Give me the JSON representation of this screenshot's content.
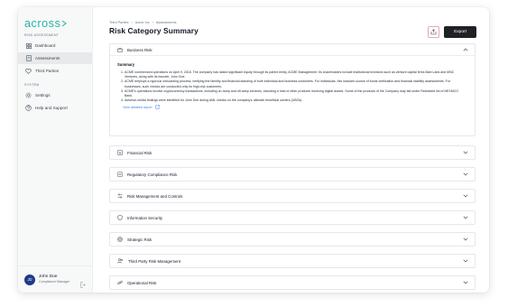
{
  "app": {
    "logo_text": "across",
    "accent": "#27b3a6",
    "sections": {
      "risk_assessment": "RISK ASSESSMENT",
      "system": "SYSTEM"
    },
    "nav": {
      "dashboard": {
        "label": "Dashboard",
        "icon": "grid-icon"
      },
      "assessments": {
        "label": "Assessments",
        "icon": "document-icon",
        "active": true
      },
      "third_parties": {
        "label": "Third Parties",
        "icon": "heart-icon"
      },
      "settings": {
        "label": "Settings",
        "icon": "gear-icon"
      },
      "help": {
        "label": "Help and Support",
        "icon": "help-circle-icon"
      }
    },
    "user": {
      "initials": "JD",
      "name": "John Doe",
      "role": "Compliance Manager"
    }
  },
  "header": {
    "breadcrumb": [
      "Third Parties",
      "Acme Inc",
      "Assessments"
    ],
    "title": "Risk Category Summary",
    "export_label": "Export"
  },
  "expanded": {
    "title": "Business Risk",
    "summary_label": "Summary",
    "items": [
      "ACME commenced operations on April 9, 2018. The company has raised significant equity through its parent entity, ACME Management. Its shareholders include institutional investors such as venture capital firms Bain Labs and MNC Ventures, along with its founder, John Doe.",
      "ACME employs a rigorous onboarding process, verifying the identity and financial standing of both individual and business customers. For individuals, this includes source of funds verification and financial stability assessments. For businesses, such checks are conducted only for high-risk customers.",
      "ACME's operations involve cryptocurrency transactions, including on-ramp and off-ramp services, including a host of other products involving digital assets. Some of the products of the Company may fall under Restricted list of NEXMCO Bank.",
      "Adverse-media findings were identified for John Doe during AML checks on the company's ultimate beneficial owners (UBOs)."
    ],
    "link": "View detailed report"
  },
  "categories": [
    {
      "label": "Financial Risk",
      "icon": "dollar-icon"
    },
    {
      "label": "Regulatory Compliance Risk",
      "icon": "clipboard-icon"
    },
    {
      "label": "Risk Management and Controls",
      "icon": "sliders-icon"
    },
    {
      "label": "Information Security",
      "icon": "shield-icon"
    },
    {
      "label": "Strategic Risk",
      "icon": "target-icon"
    },
    {
      "label": "Third Party Risk Management",
      "icon": "users-icon"
    },
    {
      "label": "Operational Risk",
      "icon": "link-icon"
    }
  ]
}
